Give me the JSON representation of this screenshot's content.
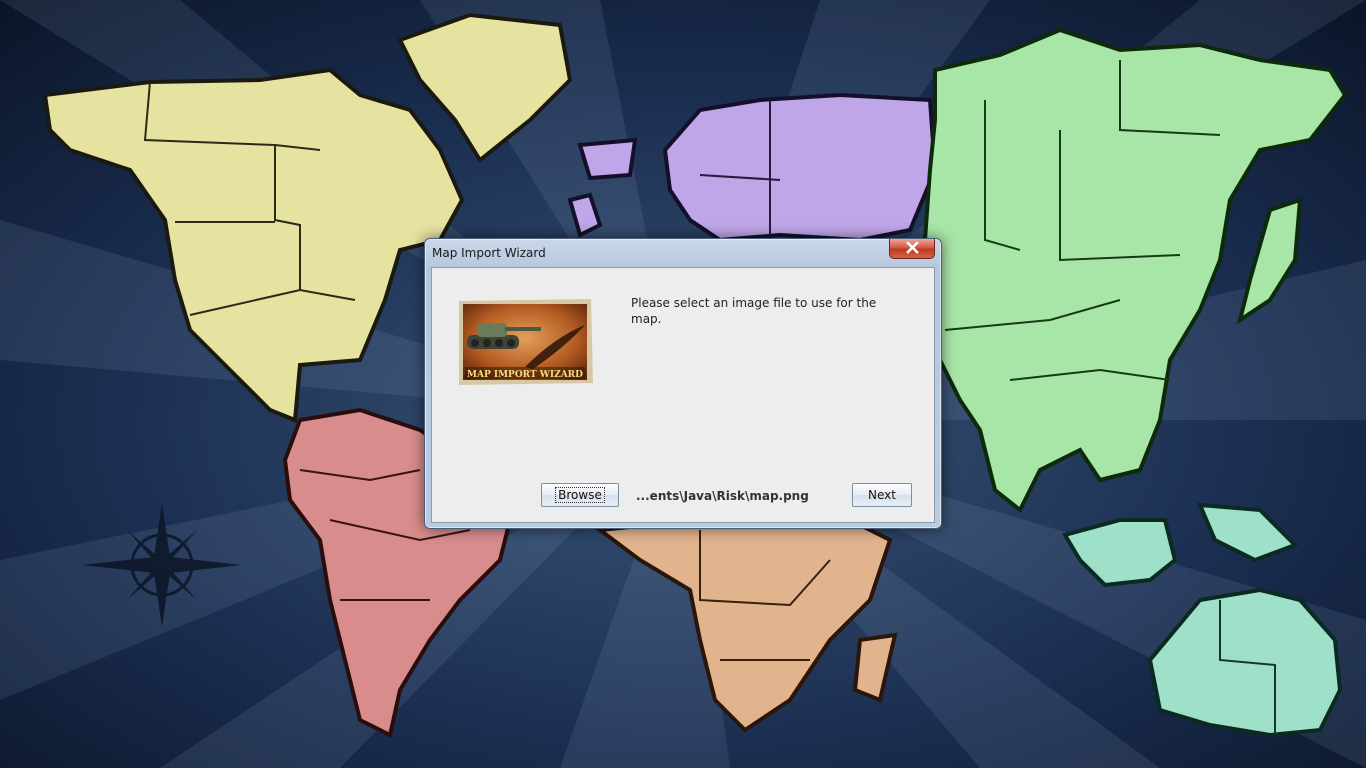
{
  "dialog": {
    "title": "Map Import Wizard",
    "close_icon": "close-icon",
    "message": "Please select an image file to use for the map.",
    "image_caption": "MAP IMPORT WIZARD",
    "browse_label": "Browse",
    "file_path": "...ents\\Java\\Risk\\map.png",
    "next_label": "Next"
  },
  "background": {
    "description_icon": "world-map",
    "compass_icon": "compass-rose-icon",
    "colors": {
      "north_america": "#e6e2a0",
      "south_america": "#d98c8c",
      "europe": "#bfa6e8",
      "africa": "#e2b48e",
      "asia": "#a8e6a8",
      "australia": "#9ee0c8",
      "ocean": "#1b2f52"
    }
  }
}
